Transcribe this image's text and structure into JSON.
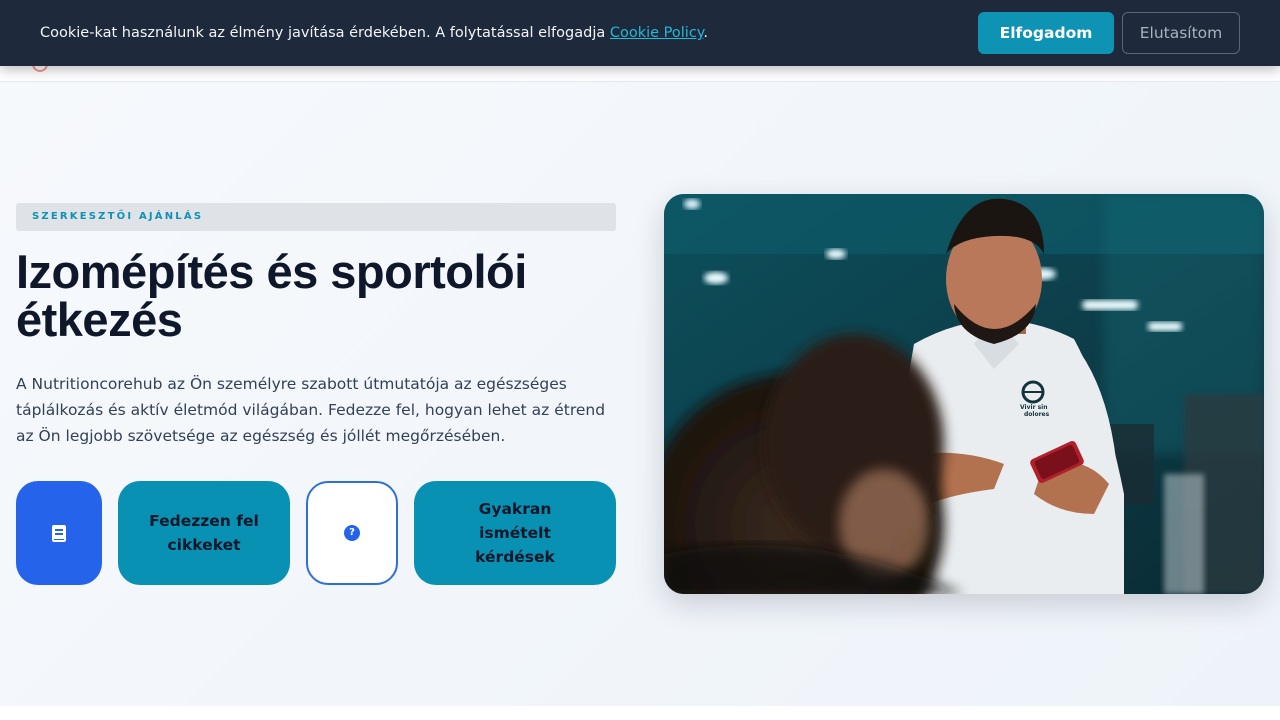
{
  "cookie": {
    "text": "Cookie-kat használunk az élmény javítása érdekében. A folytatással elfogadja ",
    "link": "Cookie Policy",
    "suffix": ".",
    "accept_label": "Elfogadom",
    "decline_label": "Elutasítom"
  },
  "hero": {
    "badge": "SZERKESZTŐI AJÁNLÁS",
    "title_line1": "Izomépítés és sportolói",
    "title_line2": "étkezés",
    "description": "A Nutritioncorehub az Ön személyre szabott útmutatója az egészséges táplálkozás és aktív életmód világában. Fedezze fel, hogyan lehet az étrend az Ön legjobb szövetsége az egészség és jóllét megőrzésében.",
    "buttons": [
      {
        "icon": "book-icon",
        "label": ""
      },
      {
        "label": "Fedezzen fel cikkeket"
      },
      {
        "icon": "help-icon",
        "label": ""
      },
      {
        "label": "Gyakran ismételt kérdések"
      }
    ],
    "image": {
      "shirt_logo_line1": "Vivir sin",
      "shirt_logo_line2": "dolores"
    }
  },
  "colors": {
    "cookie_bg": "#1e293b",
    "accent_teal": "#0891b2",
    "accent_blue": "#2563eb",
    "title": "#0f172a"
  }
}
